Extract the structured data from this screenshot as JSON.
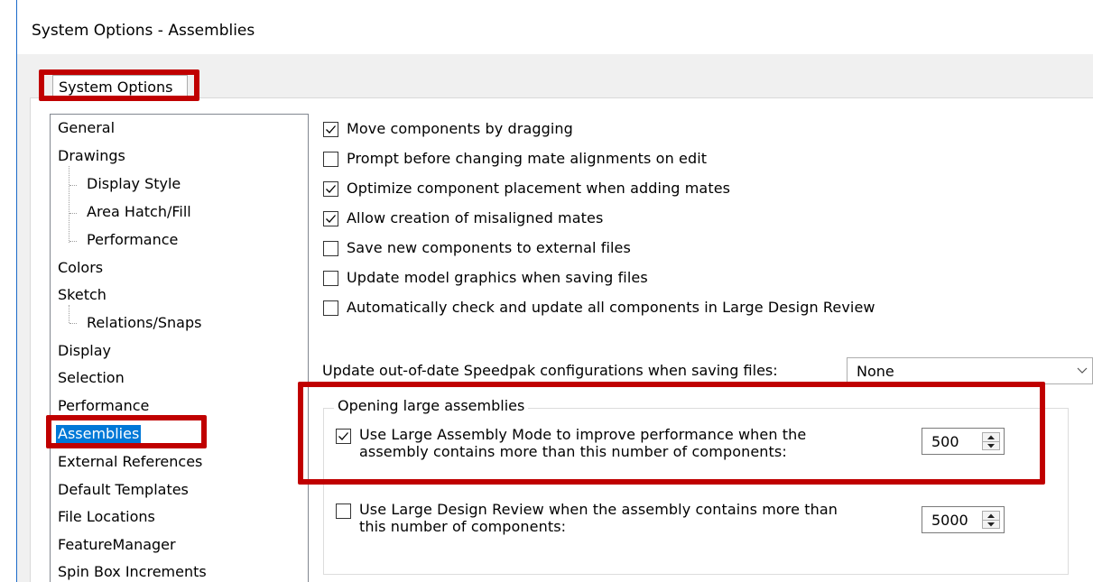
{
  "window": {
    "title": "System Options - Assemblies"
  },
  "tabs": {
    "system_options": "System Options"
  },
  "tree": {
    "items": [
      {
        "label": "General"
      },
      {
        "label": "Drawings"
      },
      {
        "label": "Display Style"
      },
      {
        "label": "Area Hatch/Fill"
      },
      {
        "label": "Performance"
      },
      {
        "label": "Colors"
      },
      {
        "label": "Sketch"
      },
      {
        "label": "Relations/Snaps"
      },
      {
        "label": "Display"
      },
      {
        "label": "Selection"
      },
      {
        "label": "Performance"
      },
      {
        "label": "Assemblies"
      },
      {
        "label": "External References"
      },
      {
        "label": "Default Templates"
      },
      {
        "label": "File Locations"
      },
      {
        "label": "FeatureManager"
      },
      {
        "label": "Spin Box Increments"
      }
    ],
    "selected": "Assemblies"
  },
  "options": [
    {
      "label": "Move components by dragging",
      "checked": true
    },
    {
      "label": "Prompt before changing mate alignments on edit",
      "checked": false
    },
    {
      "label": "Optimize component placement when adding mates",
      "checked": true
    },
    {
      "label": "Allow creation of misaligned mates",
      "checked": true
    },
    {
      "label": "Save new components to external files",
      "checked": false
    },
    {
      "label": "Update model graphics when saving files",
      "checked": false
    },
    {
      "label": "Automatically check and update all components in Large Design Review",
      "checked": false
    }
  ],
  "speedpak": {
    "label": "Update out-of-date Speedpak configurations when saving files:",
    "value": "None"
  },
  "large_assemblies": {
    "group_title": "Opening large assemblies",
    "lam_line1": "Use Large Assembly Mode to improve performance when the",
    "lam_line2": "assembly contains more than this number of components:",
    "lam_checked": true,
    "lam_value": "500",
    "ldr_line1": "Use Large Design Review when the assembly contains more than",
    "ldr_line2": "this number of components:",
    "ldr_checked": false,
    "ldr_value": "5000"
  },
  "colors": {
    "highlight": "#c00000",
    "selection": "#0078d7"
  },
  "icons": [
    "checkmark-icon",
    "chevron-down-icon",
    "spin-up-icon",
    "spin-down-icon"
  ]
}
